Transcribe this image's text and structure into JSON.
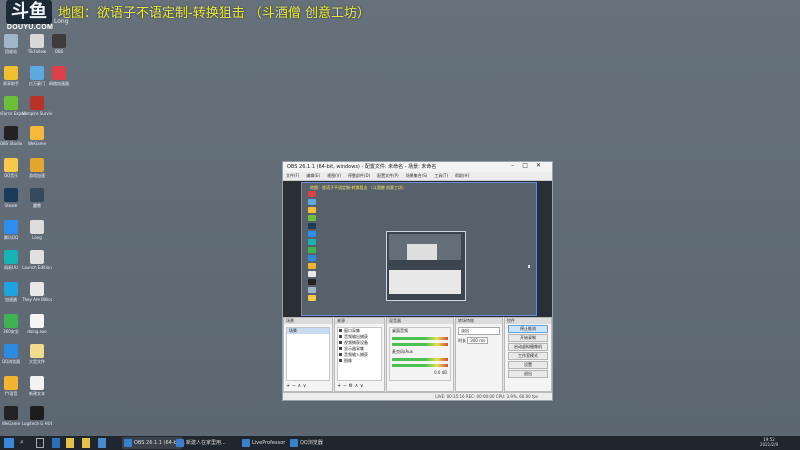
{
  "watermark": {
    "logo_text": "斗鱼",
    "url": "DOUYU.COM"
  },
  "scroll_text": "地图：欲语子不语定制-转换狙击 （斗酒僧 创意工坊）",
  "header_stamp": "Long",
  "desktop_icons": [
    {
      "label": "回收站",
      "color": "#9fb6c9"
    },
    {
      "label": "TikFollow",
      "color": "#d8d8d8"
    },
    {
      "label": "OBS",
      "color": "#3c3c3c"
    },
    {
      "label": "易享助手",
      "color": "#f0c030"
    },
    {
      "label": "亿万豪门",
      "color": "#5fa8e0"
    },
    {
      "label": "网络加速器",
      "color": "#d9404a"
    },
    {
      "label": "GeForce Experience",
      "color": "#6bbf3a"
    },
    {
      "label": "Vampire Survivors",
      "color": "#b83227"
    },
    {
      "label": "OBS Studio",
      "color": "#222"
    },
    {
      "label": "WeGame",
      "color": "#f6b93b"
    },
    {
      "label": "QQ音乐",
      "color": "#f7c948"
    },
    {
      "label": "游戏加速",
      "color": "#e3a72f"
    },
    {
      "label": "Steam",
      "color": "#1b3b5a"
    },
    {
      "label": "魔兽",
      "color": "#364a5c"
    },
    {
      "label": "腾讯QQ",
      "color": "#2d8ef0"
    },
    {
      "label": "Long",
      "color": "#dcdcdc"
    },
    {
      "label": "网易UU",
      "color": "#17b3b3"
    },
    {
      "label": "Launch Edition",
      "color": "#e0e0e0"
    },
    {
      "label": "加速器",
      "color": "#1ea2e0"
    },
    {
      "label": "They Are Billions",
      "color": "#e8e8e8"
    },
    {
      "label": "360安全",
      "color": "#3fb34f"
    },
    {
      "label": "doing.exe",
      "color": "#f5f5f5"
    },
    {
      "label": "QQ浏览器",
      "color": "#2b8be0"
    },
    {
      "label": "大型文件",
      "color": "#f0dc8c"
    },
    {
      "label": "YY语音",
      "color": "#f3b52f"
    },
    {
      "label": "新建文本",
      "color": "#f2f2f2"
    },
    {
      "label": "WeGame",
      "color": "#232323"
    },
    {
      "label": "Logitech G HUB",
      "color": "#1d1d1d"
    }
  ],
  "obs": {
    "title": "OBS 26.1.1 (64-bit, windows) - 配置文件: 未命名 - 场景: 未命名",
    "menu": [
      "文件(F)",
      "编辑(E)",
      "视图(V)",
      "停靠部件(D)",
      "配置文件(P)",
      "场景集合(S)",
      "工具(T)",
      "帮助(H)"
    ],
    "preview_text": "地图：欲语子不语定制-转换狙击 （斗酒僧 创意工坊）",
    "docks": {
      "scenes": {
        "title": "场景",
        "items": [
          "场景"
        ]
      },
      "sources": {
        "title": "来源",
        "items": [
          "窗口采集",
          "音频输出捕获",
          "视频捕获设备",
          "显示器采集",
          "音频输入捕获",
          "图像"
        ]
      },
      "mixer": {
        "title": "混音器",
        "tracks": [
          "桌面音频",
          "麦克风/Aux"
        ],
        "db": "0.0 dB"
      },
      "transitions": {
        "title": "转场特效",
        "type": "淡出",
        "duration_label": "时长",
        "duration": "300 ms"
      },
      "controls": {
        "title": "控件",
        "buttons": [
          "停止推流",
          "开始录制",
          "启动虚拟摄像机",
          "工作室模式",
          "设置",
          "退出"
        ]
      }
    },
    "status": "LIVE: 00:35:16   REC: 00:00:00   CPU: 3.9%, 60.00 fps"
  },
  "taskbar": {
    "apps": [
      "OBS 26.1.1 (64-bit...",
      "新建人在家里用...",
      "LiveProfessor",
      "QQ浏览器"
    ],
    "time": "19:52",
    "date": "2021/2/9"
  }
}
